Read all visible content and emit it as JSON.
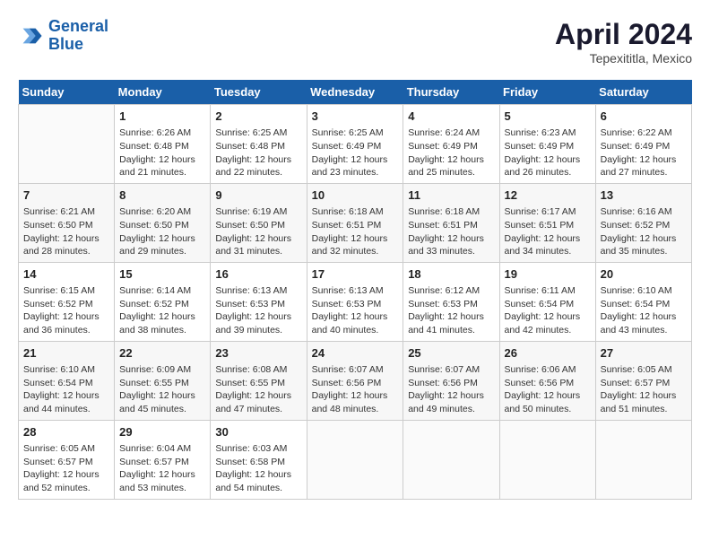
{
  "header": {
    "logo_line1": "General",
    "logo_line2": "Blue",
    "month_year": "April 2024",
    "location": "Tepexititla, Mexico"
  },
  "weekdays": [
    "Sunday",
    "Monday",
    "Tuesday",
    "Wednesday",
    "Thursday",
    "Friday",
    "Saturday"
  ],
  "weeks": [
    [
      {
        "day": "",
        "sunrise": "",
        "sunset": "",
        "daylight": ""
      },
      {
        "day": "1",
        "sunrise": "Sunrise: 6:26 AM",
        "sunset": "Sunset: 6:48 PM",
        "daylight": "Daylight: 12 hours and 21 minutes."
      },
      {
        "day": "2",
        "sunrise": "Sunrise: 6:25 AM",
        "sunset": "Sunset: 6:48 PM",
        "daylight": "Daylight: 12 hours and 22 minutes."
      },
      {
        "day": "3",
        "sunrise": "Sunrise: 6:25 AM",
        "sunset": "Sunset: 6:49 PM",
        "daylight": "Daylight: 12 hours and 23 minutes."
      },
      {
        "day": "4",
        "sunrise": "Sunrise: 6:24 AM",
        "sunset": "Sunset: 6:49 PM",
        "daylight": "Daylight: 12 hours and 25 minutes."
      },
      {
        "day": "5",
        "sunrise": "Sunrise: 6:23 AM",
        "sunset": "Sunset: 6:49 PM",
        "daylight": "Daylight: 12 hours and 26 minutes."
      },
      {
        "day": "6",
        "sunrise": "Sunrise: 6:22 AM",
        "sunset": "Sunset: 6:49 PM",
        "daylight": "Daylight: 12 hours and 27 minutes."
      }
    ],
    [
      {
        "day": "7",
        "sunrise": "Sunrise: 6:21 AM",
        "sunset": "Sunset: 6:50 PM",
        "daylight": "Daylight: 12 hours and 28 minutes."
      },
      {
        "day": "8",
        "sunrise": "Sunrise: 6:20 AM",
        "sunset": "Sunset: 6:50 PM",
        "daylight": "Daylight: 12 hours and 29 minutes."
      },
      {
        "day": "9",
        "sunrise": "Sunrise: 6:19 AM",
        "sunset": "Sunset: 6:50 PM",
        "daylight": "Daylight: 12 hours and 31 minutes."
      },
      {
        "day": "10",
        "sunrise": "Sunrise: 6:18 AM",
        "sunset": "Sunset: 6:51 PM",
        "daylight": "Daylight: 12 hours and 32 minutes."
      },
      {
        "day": "11",
        "sunrise": "Sunrise: 6:18 AM",
        "sunset": "Sunset: 6:51 PM",
        "daylight": "Daylight: 12 hours and 33 minutes."
      },
      {
        "day": "12",
        "sunrise": "Sunrise: 6:17 AM",
        "sunset": "Sunset: 6:51 PM",
        "daylight": "Daylight: 12 hours and 34 minutes."
      },
      {
        "day": "13",
        "sunrise": "Sunrise: 6:16 AM",
        "sunset": "Sunset: 6:52 PM",
        "daylight": "Daylight: 12 hours and 35 minutes."
      }
    ],
    [
      {
        "day": "14",
        "sunrise": "Sunrise: 6:15 AM",
        "sunset": "Sunset: 6:52 PM",
        "daylight": "Daylight: 12 hours and 36 minutes."
      },
      {
        "day": "15",
        "sunrise": "Sunrise: 6:14 AM",
        "sunset": "Sunset: 6:52 PM",
        "daylight": "Daylight: 12 hours and 38 minutes."
      },
      {
        "day": "16",
        "sunrise": "Sunrise: 6:13 AM",
        "sunset": "Sunset: 6:53 PM",
        "daylight": "Daylight: 12 hours and 39 minutes."
      },
      {
        "day": "17",
        "sunrise": "Sunrise: 6:13 AM",
        "sunset": "Sunset: 6:53 PM",
        "daylight": "Daylight: 12 hours and 40 minutes."
      },
      {
        "day": "18",
        "sunrise": "Sunrise: 6:12 AM",
        "sunset": "Sunset: 6:53 PM",
        "daylight": "Daylight: 12 hours and 41 minutes."
      },
      {
        "day": "19",
        "sunrise": "Sunrise: 6:11 AM",
        "sunset": "Sunset: 6:54 PM",
        "daylight": "Daylight: 12 hours and 42 minutes."
      },
      {
        "day": "20",
        "sunrise": "Sunrise: 6:10 AM",
        "sunset": "Sunset: 6:54 PM",
        "daylight": "Daylight: 12 hours and 43 minutes."
      }
    ],
    [
      {
        "day": "21",
        "sunrise": "Sunrise: 6:10 AM",
        "sunset": "Sunset: 6:54 PM",
        "daylight": "Daylight: 12 hours and 44 minutes."
      },
      {
        "day": "22",
        "sunrise": "Sunrise: 6:09 AM",
        "sunset": "Sunset: 6:55 PM",
        "daylight": "Daylight: 12 hours and 45 minutes."
      },
      {
        "day": "23",
        "sunrise": "Sunrise: 6:08 AM",
        "sunset": "Sunset: 6:55 PM",
        "daylight": "Daylight: 12 hours and 47 minutes."
      },
      {
        "day": "24",
        "sunrise": "Sunrise: 6:07 AM",
        "sunset": "Sunset: 6:56 PM",
        "daylight": "Daylight: 12 hours and 48 minutes."
      },
      {
        "day": "25",
        "sunrise": "Sunrise: 6:07 AM",
        "sunset": "Sunset: 6:56 PM",
        "daylight": "Daylight: 12 hours and 49 minutes."
      },
      {
        "day": "26",
        "sunrise": "Sunrise: 6:06 AM",
        "sunset": "Sunset: 6:56 PM",
        "daylight": "Daylight: 12 hours and 50 minutes."
      },
      {
        "day": "27",
        "sunrise": "Sunrise: 6:05 AM",
        "sunset": "Sunset: 6:57 PM",
        "daylight": "Daylight: 12 hours and 51 minutes."
      }
    ],
    [
      {
        "day": "28",
        "sunrise": "Sunrise: 6:05 AM",
        "sunset": "Sunset: 6:57 PM",
        "daylight": "Daylight: 12 hours and 52 minutes."
      },
      {
        "day": "29",
        "sunrise": "Sunrise: 6:04 AM",
        "sunset": "Sunset: 6:57 PM",
        "daylight": "Daylight: 12 hours and 53 minutes."
      },
      {
        "day": "30",
        "sunrise": "Sunrise: 6:03 AM",
        "sunset": "Sunset: 6:58 PM",
        "daylight": "Daylight: 12 hours and 54 minutes."
      },
      {
        "day": "",
        "sunrise": "",
        "sunset": "",
        "daylight": ""
      },
      {
        "day": "",
        "sunrise": "",
        "sunset": "",
        "daylight": ""
      },
      {
        "day": "",
        "sunrise": "",
        "sunset": "",
        "daylight": ""
      },
      {
        "day": "",
        "sunrise": "",
        "sunset": "",
        "daylight": ""
      }
    ]
  ]
}
